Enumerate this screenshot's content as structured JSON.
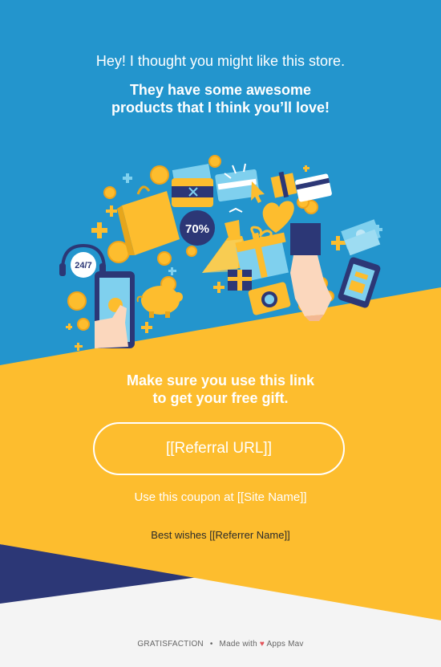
{
  "header": {
    "greeting": "Hey! I thought you might like this store.",
    "pitch_line1": "They have some awesome",
    "pitch_line2": "products that I think you’ll love!"
  },
  "illustration": {
    "badge_percent": "70%",
    "badge_support": "24/7",
    "icons": [
      "shopping-bag-icon",
      "wallet-icon",
      "credit-card-icon",
      "gift-icon",
      "phone-icon",
      "dress-icon",
      "piggy-bank-icon",
      "camera-icon",
      "coin-icon",
      "cash-icon",
      "heart-icon",
      "headset-icon",
      "hand-icon"
    ]
  },
  "main": {
    "instruction_line1": "Make sure you use this link",
    "instruction_line2": "to get your free gift.",
    "referral_button": "[[Referral URL]]",
    "coupon_text": "Use this coupon at [[Site Name]]",
    "sign_off": "Best wishes [[Referrer Name]]"
  },
  "footer": {
    "brand": "GRATISFACTION",
    "separator": "•",
    "made_with": "Made with",
    "heart": "♥",
    "maker": "Apps Mav"
  },
  "colors": {
    "blue": "#2395cd",
    "yellow": "#fdbd2e",
    "navy": "#2c3776",
    "footer_bg": "#f4f4f4",
    "heart": "#e2545a"
  }
}
